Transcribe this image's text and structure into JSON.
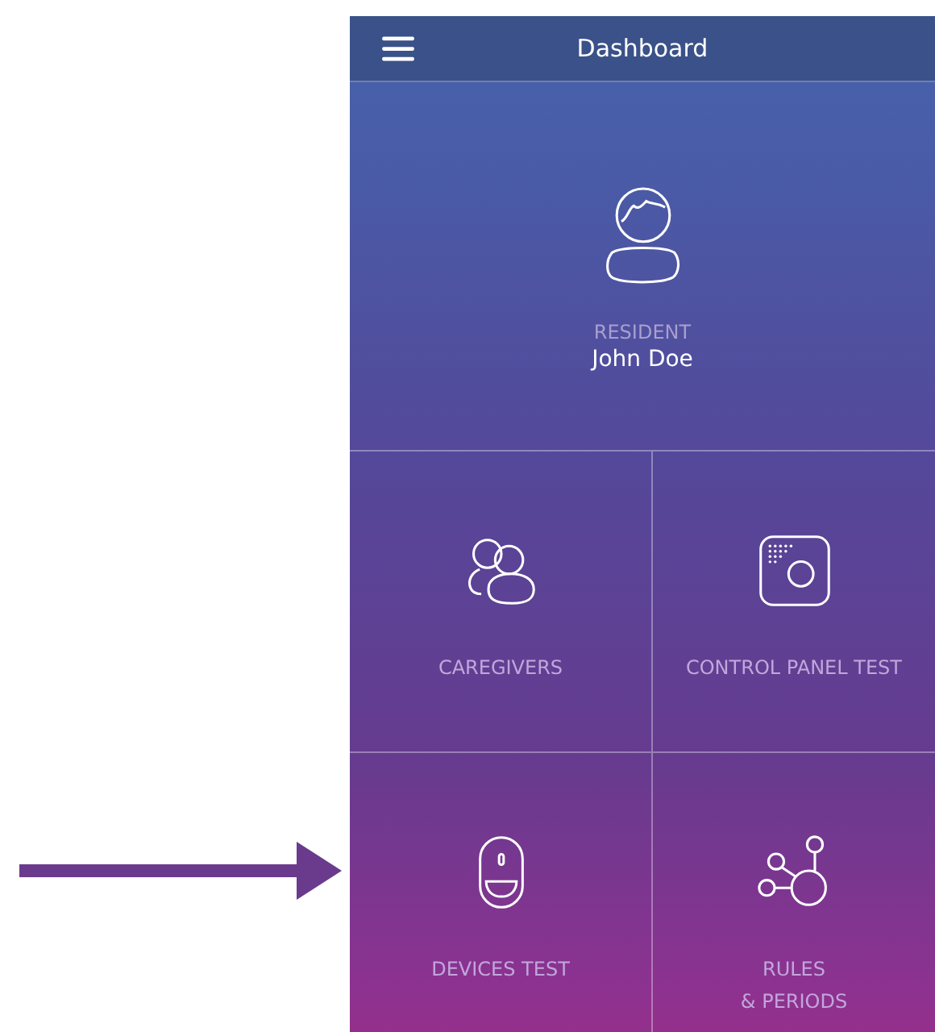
{
  "header": {
    "title": "Dashboard"
  },
  "resident": {
    "label": "RESIDENT",
    "name": "John Doe"
  },
  "tiles": [
    {
      "kind": "caregivers",
      "label": "CAREGIVERS"
    },
    {
      "kind": "control_panel",
      "label": "CONTROL PANEL TEST"
    },
    {
      "kind": "device",
      "label": "DEVICES TEST"
    },
    {
      "kind": "rules",
      "label": "RULES\n& PERIODS"
    }
  ]
}
